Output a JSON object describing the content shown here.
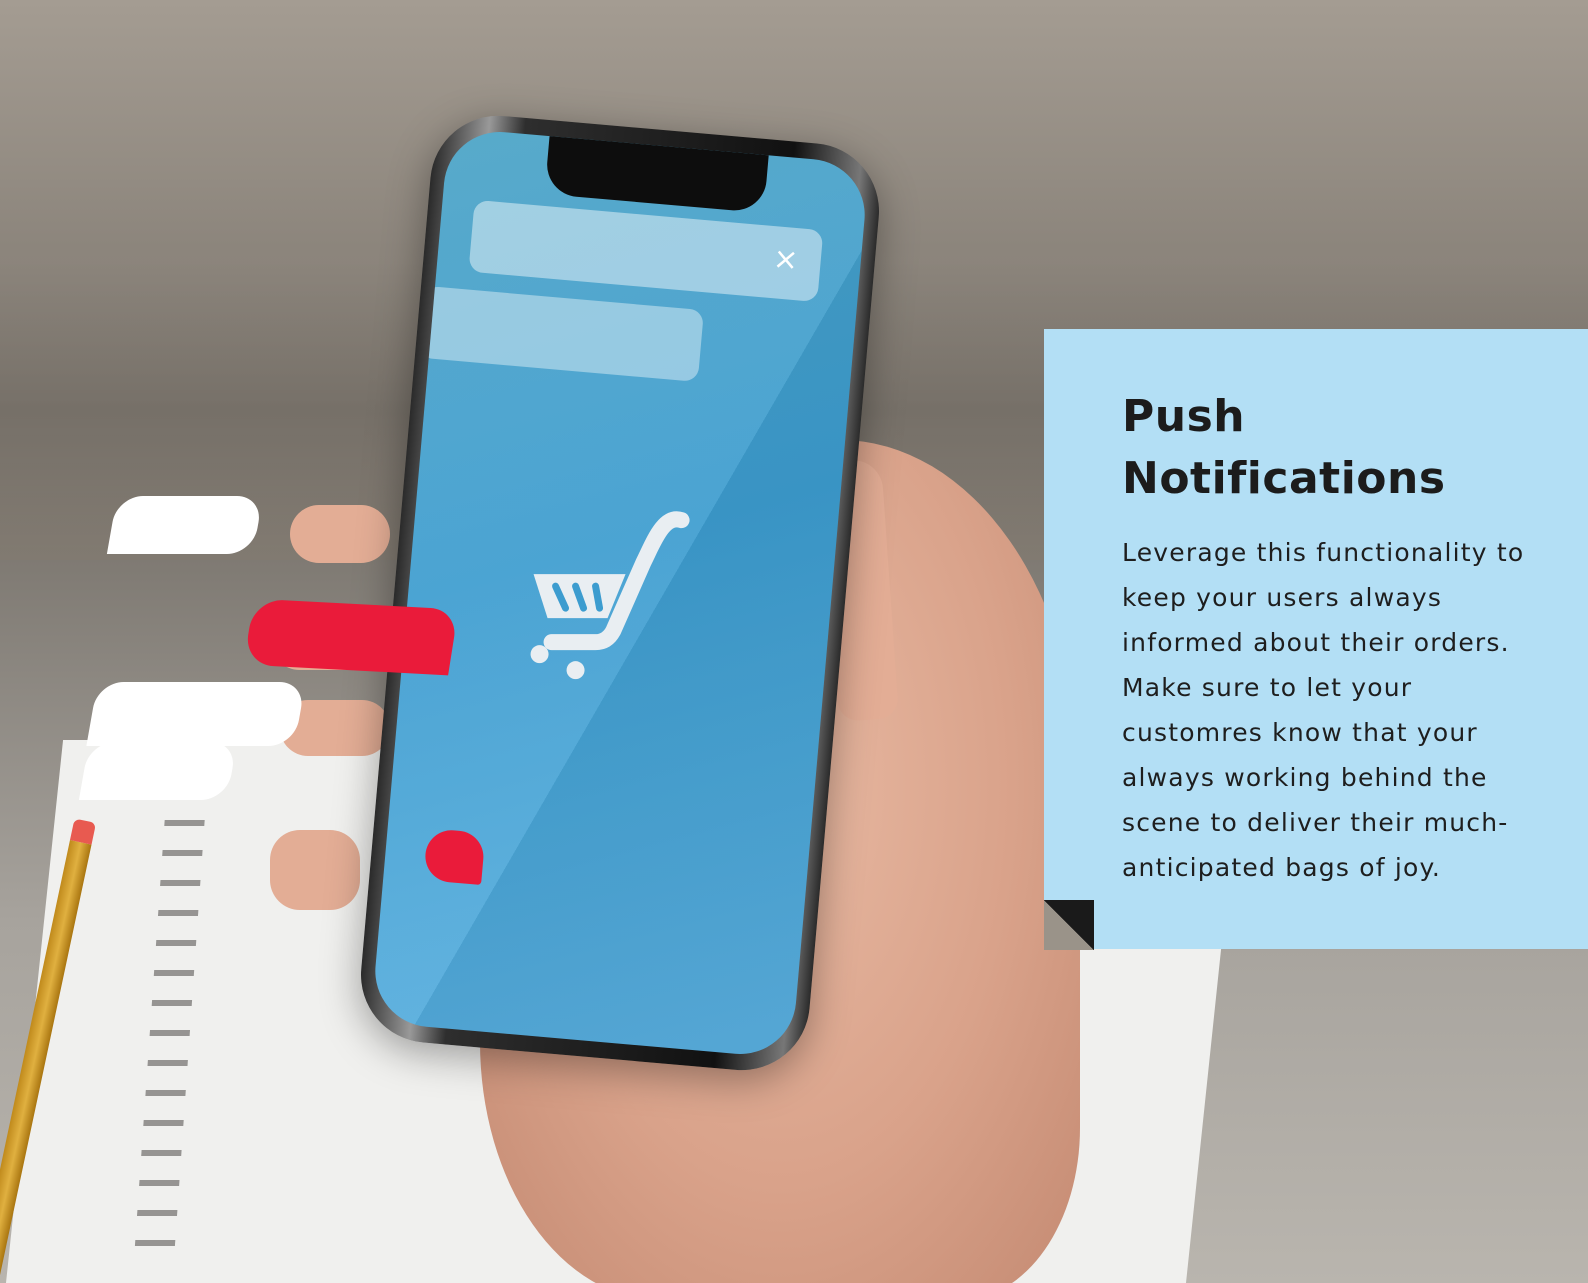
{
  "feature": {
    "title_line1": "Push",
    "title_line2": "Notifications",
    "body": "Leverage this functionality to keep your users always informed about their orders. Make sure to let your customres know that your always working behind the scene to deliver their much-anticipated bags of joy."
  },
  "phone": {
    "close_glyph": "×"
  },
  "colors": {
    "panel": "#b3dff5",
    "accent_red": "#ea1b3a",
    "screen_blue": "#3c9ccf",
    "title_text": "#1c1c1c"
  },
  "icons": [
    "close-icon",
    "shopping-cart-icon"
  ]
}
